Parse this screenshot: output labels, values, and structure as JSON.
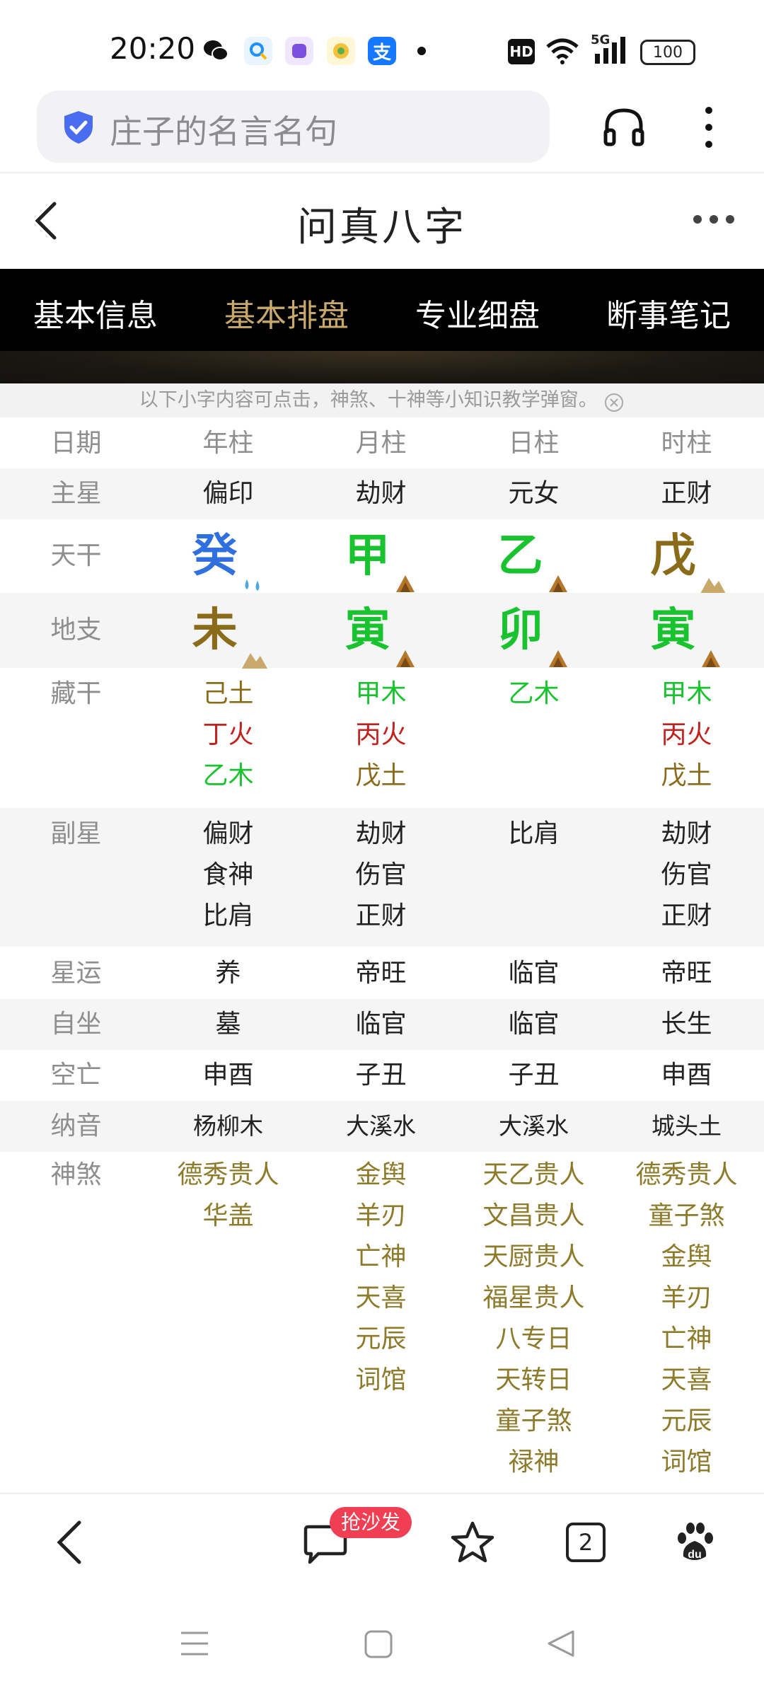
{
  "status_bar": {
    "time": "20:20",
    "icons": [
      "wechat-icon",
      "search-app-icon",
      "purple-app-icon",
      "qa-app-icon",
      "alipay-icon",
      "dot-icon",
      "hd-icon",
      "wifi-icon",
      "5g-signal-icon",
      "battery-icon"
    ],
    "hd": "HD",
    "network": "5G",
    "battery": "100",
    "alipay_glyph": "支"
  },
  "browser": {
    "search_text": "庄子的名言名句"
  },
  "page": {
    "title": "问真八字"
  },
  "tabs": [
    "基本信息",
    "基本排盘",
    "专业细盘",
    "断事笔记"
  ],
  "active_tab": "基本排盘",
  "notice": "以下小字内容可点击，神煞、十神等小知识教学弹窗。",
  "table": {
    "header": [
      "日期",
      "年柱",
      "月柱",
      "日柱",
      "时柱"
    ],
    "main_star": {
      "label": "主星",
      "values": [
        "偏印",
        "劫财",
        "元女",
        "正财"
      ]
    },
    "stems": {
      "label": "天干",
      "values": [
        "癸",
        "甲",
        "乙",
        "戊"
      ]
    },
    "branches": {
      "label": "地支",
      "values": [
        "未",
        "寅",
        "卯",
        "寅"
      ]
    },
    "hidden": {
      "label": "藏干",
      "col1": [
        "己土",
        "丁火",
        "乙木"
      ],
      "col2": [
        "甲木",
        "丙火",
        "戊土"
      ],
      "col3": [
        "乙木"
      ],
      "col4": [
        "甲木",
        "丙火",
        "戊土"
      ]
    },
    "sub_star": {
      "label": "副星",
      "col1": [
        "偏财",
        "食神",
        "比肩"
      ],
      "col2": [
        "劫财",
        "伤官",
        "正财"
      ],
      "col3": [
        "比肩"
      ],
      "col4": [
        "劫财",
        "伤官",
        "正财"
      ]
    },
    "star_luck": {
      "label": "星运",
      "values": [
        "养",
        "帝旺",
        "临官",
        "帝旺"
      ]
    },
    "self_seat": {
      "label": "自坐",
      "values": [
        "墓",
        "临官",
        "临官",
        "长生"
      ]
    },
    "void": {
      "label": "空亡",
      "values": [
        "申酉",
        "子丑",
        "子丑",
        "申酉"
      ]
    },
    "nayin": {
      "label": "纳音",
      "values": [
        "杨柳木",
        "大溪水",
        "大溪水",
        "城头土"
      ]
    },
    "shensha": {
      "label": "神煞",
      "col1": [
        "德秀贵人",
        "华盖"
      ],
      "col2": [
        "金舆",
        "羊刃",
        "亡神",
        "天喜",
        "元辰",
        "词馆"
      ],
      "col3": [
        "天乙贵人",
        "文昌贵人",
        "天厨贵人",
        "福星贵人",
        "八专日",
        "天转日",
        "童子煞",
        "禄神"
      ],
      "col4": [
        "德秀贵人",
        "童子煞",
        "金舆",
        "羊刃",
        "亡神",
        "天喜",
        "元辰",
        "词馆"
      ]
    }
  },
  "bottom_nav": {
    "sofa_label": "抢沙发",
    "tab_count": "2"
  },
  "colors": {
    "tab_active": "#c8a96b",
    "earth": "#8a6b1a",
    "wood": "#19c22f",
    "fire": "#c0231f",
    "water": "#2f6fe0",
    "shensha": "#8d7a2a",
    "sofa_badge": "#f03f52"
  }
}
